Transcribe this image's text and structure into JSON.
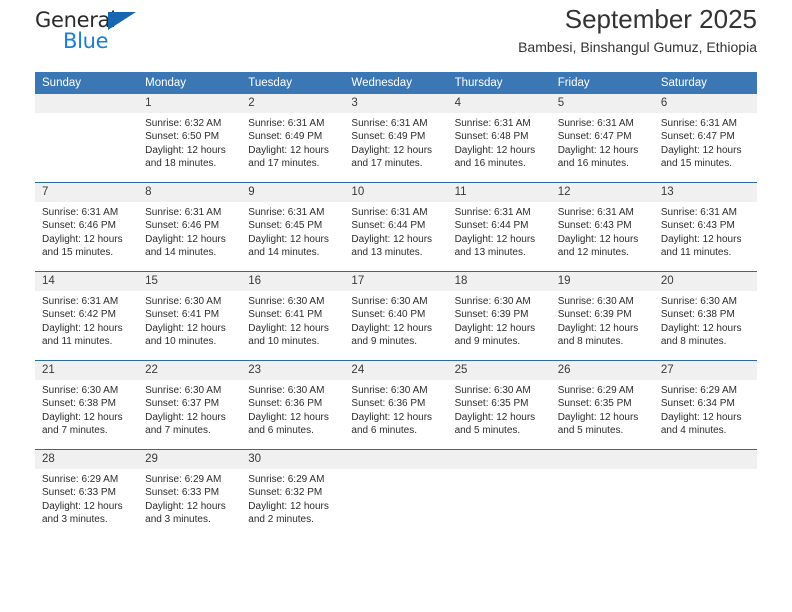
{
  "brand": {
    "word_one": "General",
    "word_two": "Blue",
    "triangle_color": "#1667b0",
    "blue_text_color": "#1a7fd4"
  },
  "header": {
    "title": "September 2025",
    "subtitle": "Bambesi, Binshangul Gumuz, Ethiopia"
  },
  "theme": {
    "header_bg": "#3b77b5",
    "row_divider": "#2a6ba8",
    "daynum_bg": "#f0f0f0"
  },
  "calendar": {
    "weekday_headers": [
      "Sunday",
      "Monday",
      "Tuesday",
      "Wednesday",
      "Thursday",
      "Friday",
      "Saturday"
    ],
    "weeks": [
      [
        {
          "day": "",
          "sunrise": "",
          "sunset": "",
          "daylight_line1": "",
          "daylight_line2": ""
        },
        {
          "day": "1",
          "sunrise": "Sunrise: 6:32 AM",
          "sunset": "Sunset: 6:50 PM",
          "daylight_line1": "Daylight: 12 hours",
          "daylight_line2": "and 18 minutes."
        },
        {
          "day": "2",
          "sunrise": "Sunrise: 6:31 AM",
          "sunset": "Sunset: 6:49 PM",
          "daylight_line1": "Daylight: 12 hours",
          "daylight_line2": "and 17 minutes."
        },
        {
          "day": "3",
          "sunrise": "Sunrise: 6:31 AM",
          "sunset": "Sunset: 6:49 PM",
          "daylight_line1": "Daylight: 12 hours",
          "daylight_line2": "and 17 minutes."
        },
        {
          "day": "4",
          "sunrise": "Sunrise: 6:31 AM",
          "sunset": "Sunset: 6:48 PM",
          "daylight_line1": "Daylight: 12 hours",
          "daylight_line2": "and 16 minutes."
        },
        {
          "day": "5",
          "sunrise": "Sunrise: 6:31 AM",
          "sunset": "Sunset: 6:47 PM",
          "daylight_line1": "Daylight: 12 hours",
          "daylight_line2": "and 16 minutes."
        },
        {
          "day": "6",
          "sunrise": "Sunrise: 6:31 AM",
          "sunset": "Sunset: 6:47 PM",
          "daylight_line1": "Daylight: 12 hours",
          "daylight_line2": "and 15 minutes."
        }
      ],
      [
        {
          "day": "7",
          "sunrise": "Sunrise: 6:31 AM",
          "sunset": "Sunset: 6:46 PM",
          "daylight_line1": "Daylight: 12 hours",
          "daylight_line2": "and 15 minutes."
        },
        {
          "day": "8",
          "sunrise": "Sunrise: 6:31 AM",
          "sunset": "Sunset: 6:46 PM",
          "daylight_line1": "Daylight: 12 hours",
          "daylight_line2": "and 14 minutes."
        },
        {
          "day": "9",
          "sunrise": "Sunrise: 6:31 AM",
          "sunset": "Sunset: 6:45 PM",
          "daylight_line1": "Daylight: 12 hours",
          "daylight_line2": "and 14 minutes."
        },
        {
          "day": "10",
          "sunrise": "Sunrise: 6:31 AM",
          "sunset": "Sunset: 6:44 PM",
          "daylight_line1": "Daylight: 12 hours",
          "daylight_line2": "and 13 minutes."
        },
        {
          "day": "11",
          "sunrise": "Sunrise: 6:31 AM",
          "sunset": "Sunset: 6:44 PM",
          "daylight_line1": "Daylight: 12 hours",
          "daylight_line2": "and 13 minutes."
        },
        {
          "day": "12",
          "sunrise": "Sunrise: 6:31 AM",
          "sunset": "Sunset: 6:43 PM",
          "daylight_line1": "Daylight: 12 hours",
          "daylight_line2": "and 12 minutes."
        },
        {
          "day": "13",
          "sunrise": "Sunrise: 6:31 AM",
          "sunset": "Sunset: 6:43 PM",
          "daylight_line1": "Daylight: 12 hours",
          "daylight_line2": "and 11 minutes."
        }
      ],
      [
        {
          "day": "14",
          "sunrise": "Sunrise: 6:31 AM",
          "sunset": "Sunset: 6:42 PM",
          "daylight_line1": "Daylight: 12 hours",
          "daylight_line2": "and 11 minutes."
        },
        {
          "day": "15",
          "sunrise": "Sunrise: 6:30 AM",
          "sunset": "Sunset: 6:41 PM",
          "daylight_line1": "Daylight: 12 hours",
          "daylight_line2": "and 10 minutes."
        },
        {
          "day": "16",
          "sunrise": "Sunrise: 6:30 AM",
          "sunset": "Sunset: 6:41 PM",
          "daylight_line1": "Daylight: 12 hours",
          "daylight_line2": "and 10 minutes."
        },
        {
          "day": "17",
          "sunrise": "Sunrise: 6:30 AM",
          "sunset": "Sunset: 6:40 PM",
          "daylight_line1": "Daylight: 12 hours",
          "daylight_line2": "and 9 minutes."
        },
        {
          "day": "18",
          "sunrise": "Sunrise: 6:30 AM",
          "sunset": "Sunset: 6:39 PM",
          "daylight_line1": "Daylight: 12 hours",
          "daylight_line2": "and 9 minutes."
        },
        {
          "day": "19",
          "sunrise": "Sunrise: 6:30 AM",
          "sunset": "Sunset: 6:39 PM",
          "daylight_line1": "Daylight: 12 hours",
          "daylight_line2": "and 8 minutes."
        },
        {
          "day": "20",
          "sunrise": "Sunrise: 6:30 AM",
          "sunset": "Sunset: 6:38 PM",
          "daylight_line1": "Daylight: 12 hours",
          "daylight_line2": "and 8 minutes."
        }
      ],
      [
        {
          "day": "21",
          "sunrise": "Sunrise: 6:30 AM",
          "sunset": "Sunset: 6:38 PM",
          "daylight_line1": "Daylight: 12 hours",
          "daylight_line2": "and 7 minutes."
        },
        {
          "day": "22",
          "sunrise": "Sunrise: 6:30 AM",
          "sunset": "Sunset: 6:37 PM",
          "daylight_line1": "Daylight: 12 hours",
          "daylight_line2": "and 7 minutes."
        },
        {
          "day": "23",
          "sunrise": "Sunrise: 6:30 AM",
          "sunset": "Sunset: 6:36 PM",
          "daylight_line1": "Daylight: 12 hours",
          "daylight_line2": "and 6 minutes."
        },
        {
          "day": "24",
          "sunrise": "Sunrise: 6:30 AM",
          "sunset": "Sunset: 6:36 PM",
          "daylight_line1": "Daylight: 12 hours",
          "daylight_line2": "and 6 minutes."
        },
        {
          "day": "25",
          "sunrise": "Sunrise: 6:30 AM",
          "sunset": "Sunset: 6:35 PM",
          "daylight_line1": "Daylight: 12 hours",
          "daylight_line2": "and 5 minutes."
        },
        {
          "day": "26",
          "sunrise": "Sunrise: 6:29 AM",
          "sunset": "Sunset: 6:35 PM",
          "daylight_line1": "Daylight: 12 hours",
          "daylight_line2": "and 5 minutes."
        },
        {
          "day": "27",
          "sunrise": "Sunrise: 6:29 AM",
          "sunset": "Sunset: 6:34 PM",
          "daylight_line1": "Daylight: 12 hours",
          "daylight_line2": "and 4 minutes."
        }
      ],
      [
        {
          "day": "28",
          "sunrise": "Sunrise: 6:29 AM",
          "sunset": "Sunset: 6:33 PM",
          "daylight_line1": "Daylight: 12 hours",
          "daylight_line2": "and 3 minutes."
        },
        {
          "day": "29",
          "sunrise": "Sunrise: 6:29 AM",
          "sunset": "Sunset: 6:33 PM",
          "daylight_line1": "Daylight: 12 hours",
          "daylight_line2": "and 3 minutes."
        },
        {
          "day": "30",
          "sunrise": "Sunrise: 6:29 AM",
          "sunset": "Sunset: 6:32 PM",
          "daylight_line1": "Daylight: 12 hours",
          "daylight_line2": "and 2 minutes."
        },
        {
          "day": "",
          "sunrise": "",
          "sunset": "",
          "daylight_line1": "",
          "daylight_line2": ""
        },
        {
          "day": "",
          "sunrise": "",
          "sunset": "",
          "daylight_line1": "",
          "daylight_line2": ""
        },
        {
          "day": "",
          "sunrise": "",
          "sunset": "",
          "daylight_line1": "",
          "daylight_line2": ""
        },
        {
          "day": "",
          "sunrise": "",
          "sunset": "",
          "daylight_line1": "",
          "daylight_line2": ""
        }
      ]
    ]
  }
}
